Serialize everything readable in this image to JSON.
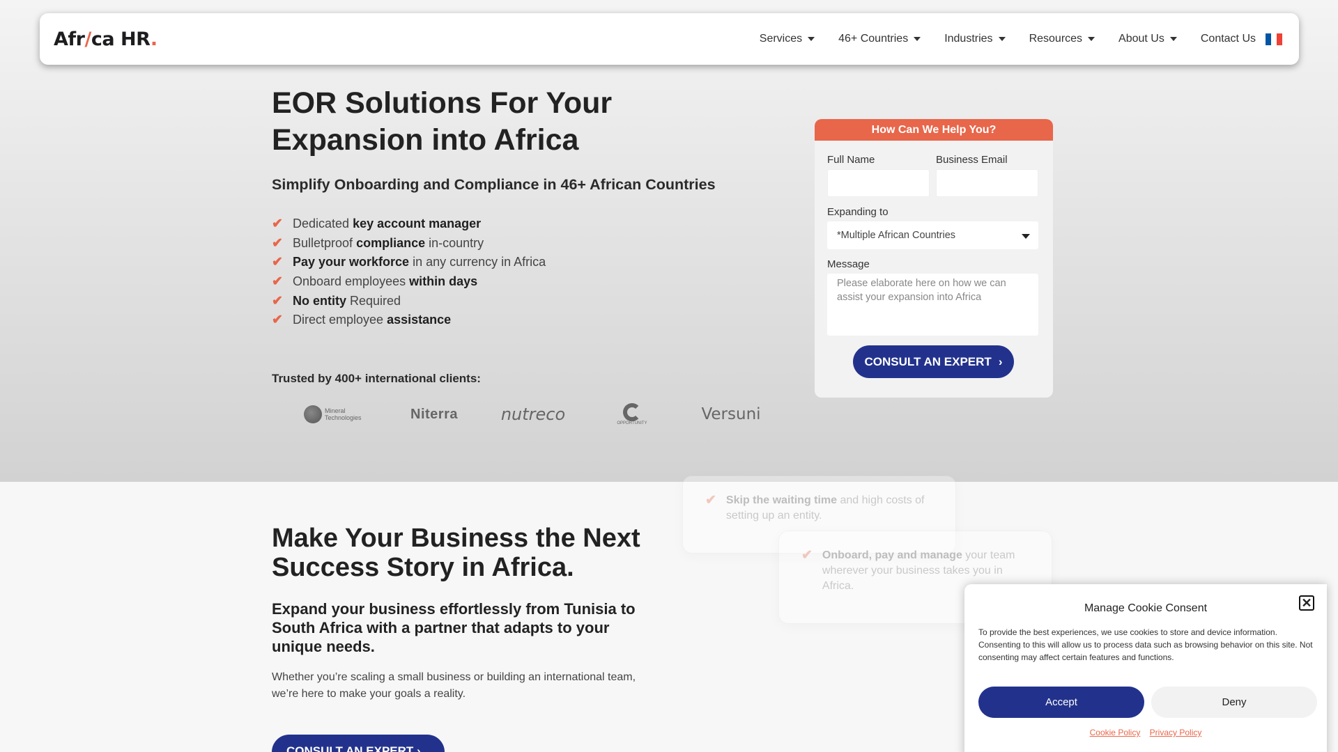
{
  "nav": {
    "logo": {
      "pre": "Afr",
      "slash": "/",
      "post": "ca HR",
      "dot": "."
    },
    "items": [
      {
        "label": "Services"
      },
      {
        "label": "46+ Countries"
      },
      {
        "label": "Industries"
      },
      {
        "label": "Resources"
      },
      {
        "label": "About Us"
      },
      {
        "label": "Contact Us"
      }
    ],
    "flag_colors": [
      "#0055a4",
      "#ffffff",
      "#ef4135"
    ]
  },
  "hero": {
    "title": "EOR Solutions For Your Expansion into Africa",
    "subtitle": "Simplify Onboarding and Compliance in 46+ African Countries",
    "checks": [
      {
        "pre": "Dedicated ",
        "bold": "key account manager",
        "post": ""
      },
      {
        "pre": "Bulletproof ",
        "bold": "compliance",
        "post": " in-country"
      },
      {
        "pre": "",
        "bold": "Pay your workforce",
        "post": " in any currency in Africa"
      },
      {
        "pre": "Onboard employees ",
        "bold": "within days",
        "post": ""
      },
      {
        "pre": "",
        "bold": "No entity",
        "post": " Required"
      },
      {
        "pre": "Direct employee ",
        "bold": "assistance",
        "post": ""
      }
    ],
    "trusted": "Trusted by 400+ international clients:",
    "client_logos": {
      "mineral": "Mineral Technologies",
      "niterra": "Niterra",
      "nutreco": "nutreco",
      "opportunity": "OPPORTUNITY",
      "versuni": "Versuni"
    }
  },
  "form": {
    "header": "How Can We Help You?",
    "full_name_label": "Full Name",
    "email_label": "Business Email",
    "expanding_label": "Expanding to",
    "expanding_value": "*Multiple African Countries",
    "message_label": "Message",
    "message_placeholder": "Please elaborate here on how we can assist your expansion into Africa",
    "submit": "CONSULT AN EXPERT"
  },
  "lower": {
    "title": "Make Your Business the Next Success Story in Africa.",
    "subtitle": "Expand your business effortlessly from Tunisia to South Africa with a partner that adapts to your unique needs.",
    "paragraph": "Whether you’re scaling a small business or building an international team, we’re here to make your goals a reality.",
    "button": "CONSULT AN EXPERT",
    "ghost_cards": [
      {
        "bold": "Skip the waiting time",
        "rest": " and high costs of setting up an entity."
      },
      {
        "bold": "Onboard, pay and manage",
        "rest": " your team wherever your business takes you in Africa."
      }
    ]
  },
  "cookie": {
    "title": "Manage Cookie Consent",
    "close": "✕",
    "text": "To provide the best experiences, we use cookies to store and device information. Consenting to this will allow us to process data such as browsing behavior on this site. Not consenting may affect certain features and functions.",
    "accept": "Accept",
    "deny": "Deny",
    "cookie_policy": "Cookie Policy",
    "privacy_policy": "Privacy Policy"
  },
  "colors": {
    "accent": "#e8664a",
    "primary": "#22328c"
  }
}
